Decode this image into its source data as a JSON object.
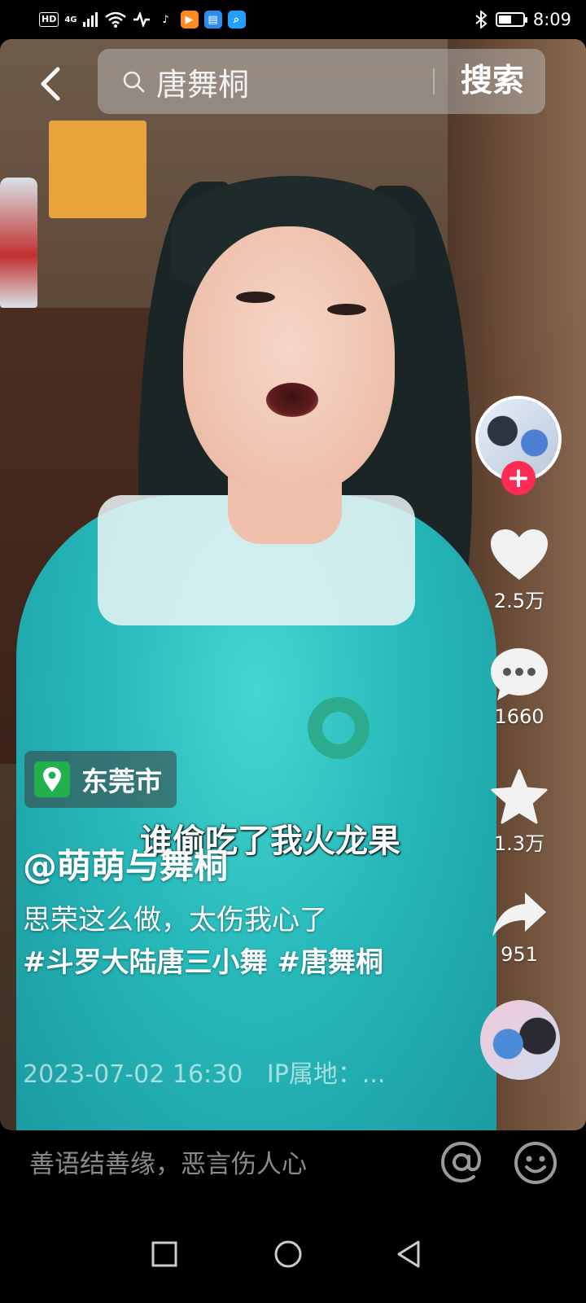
{
  "status_bar": {
    "hd": "HD",
    "network": "4G",
    "time": "8:09",
    "battery_level": 0.55,
    "icons": [
      "wifi-icon",
      "tiktok-app-icon",
      "orange-app-icon",
      "book-app-icon",
      "search-app-icon",
      "bluetooth-icon",
      "battery-icon"
    ]
  },
  "search": {
    "query": "唐舞桐",
    "button_label": "搜索"
  },
  "actions": {
    "like_count": "2.5万",
    "comment_count": "1660",
    "favorite_count": "1.3万",
    "share_count": "951",
    "follow_symbol": "+"
  },
  "video": {
    "location": "东莞市",
    "subtitle": "谁偷吃了我火龙果",
    "author": "@萌萌与舞桐",
    "description_text": "思荣这么做，太伤我心了",
    "hashtags": "#斗罗大陆唐三小舞 #唐舞桐",
    "date": "2023-07-02 16:30",
    "ip": "IP属地：..."
  },
  "comment_bar": {
    "placeholder": "善语结善缘，恶言伤人心"
  },
  "colors": {
    "accent_red": "#fe2c55",
    "location_green": "#21b04b",
    "dress_teal": "#27b9ba"
  }
}
